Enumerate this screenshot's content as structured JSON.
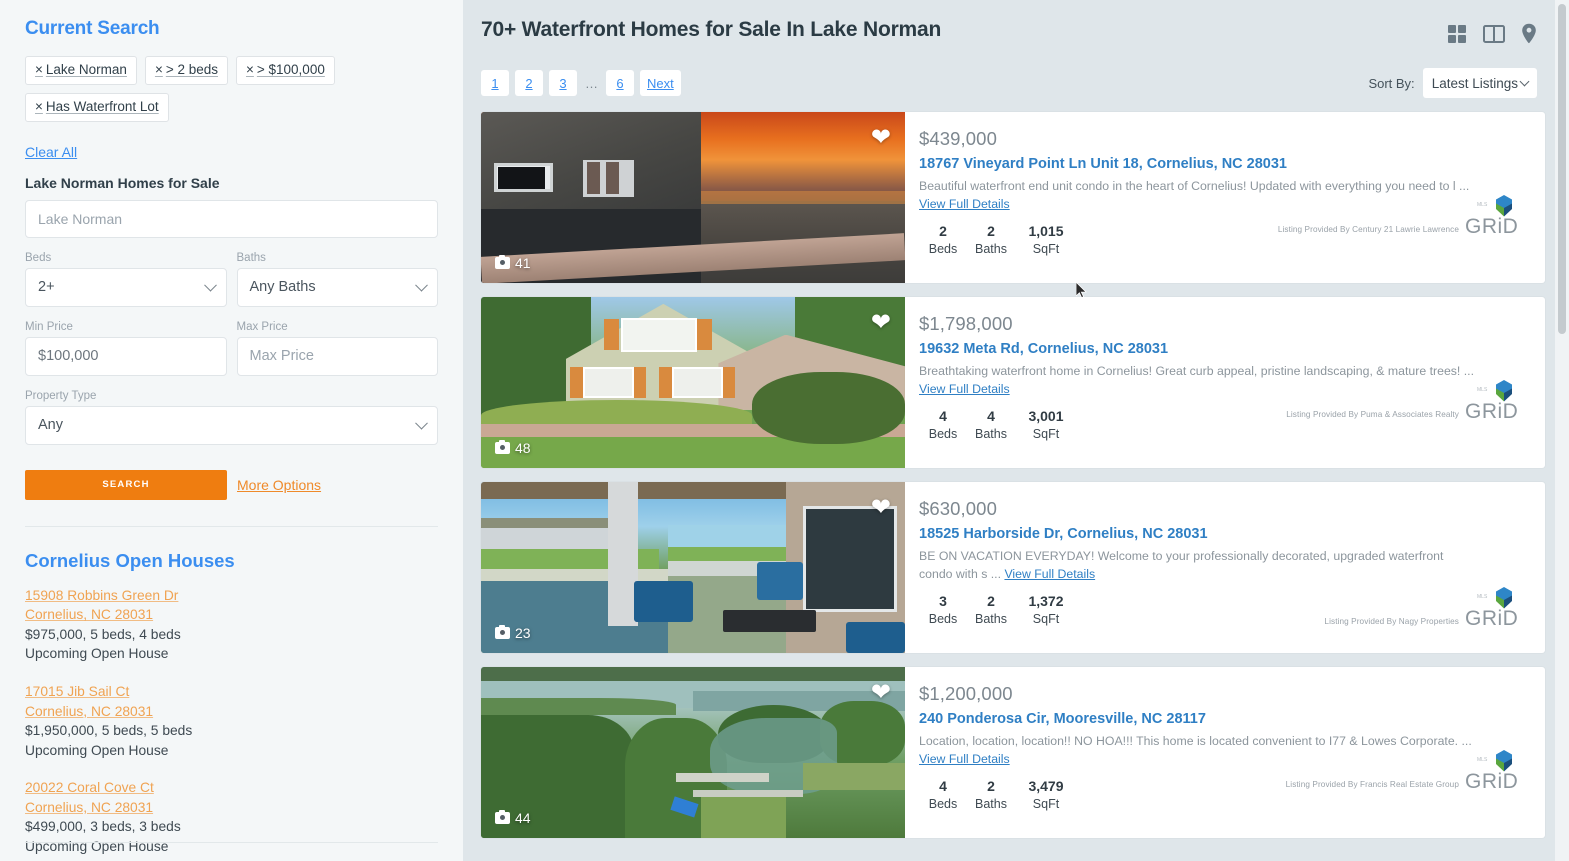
{
  "sidebar": {
    "current_search_title": "Current Search",
    "chips": [
      {
        "x": "×",
        "label": "Lake Norman"
      },
      {
        "x": "×",
        "label": "> 2 beds"
      },
      {
        "x": "×",
        "label": "> $100,000"
      },
      {
        "x": "×",
        "label": "Has Waterfront Lot"
      }
    ],
    "clear_all": "Clear All",
    "location_heading": "Lake Norman Homes for Sale",
    "location_input_value": "Lake Norman",
    "location_input_placeholder": "Lake Norman",
    "beds_label": "Beds",
    "beds_value": "2+",
    "baths_label": "Baths",
    "baths_value": "Any Baths",
    "min_price_label": "Min Price",
    "min_price_value": "$100,000",
    "max_price_label": "Max Price",
    "max_price_placeholder": "Max Price",
    "property_type_label": "Property Type",
    "property_type_value": "Any",
    "search_button": "SEARCH",
    "more_options": "More Options",
    "open_houses_title": "Cornelius Open Houses",
    "open_houses": [
      {
        "street": "15908 Robbins Green Dr",
        "citystatezip": "Cornelius, NC 28031",
        "meta": "$975,000, 5 beds, 4 beds",
        "status": "Upcoming Open House"
      },
      {
        "street": "17015 Jib Sail Ct",
        "citystatezip": "Cornelius, NC 28031",
        "meta": "$1,950,000, 5 beds, 5 beds",
        "status": "Upcoming Open House"
      },
      {
        "street": "20022 Coral Cove Ct",
        "citystatezip": "Cornelius, NC 28031",
        "meta": "$499,000, 3 beds, 3 beds",
        "status": "Upcoming Open House"
      }
    ]
  },
  "main": {
    "title": "70+ Waterfront Homes for Sale In Lake Norman",
    "view_icons": [
      "grid-view-icon",
      "split-view-icon",
      "map-view-icon"
    ],
    "pagination": [
      "1",
      "2",
      "3",
      "…",
      "6",
      "Next"
    ],
    "sort_by_label": "Sort By:",
    "sort_by_value": "Latest Listings",
    "stat_labels": {
      "beds": "Beds",
      "baths": "Baths",
      "sqft": "SqFt"
    },
    "grid_logo_text": "GRiD",
    "grid_logo_mls": "MLS"
  },
  "listings": [
    {
      "price": "$439,000",
      "address": "18767 Vineyard Point Ln Unit 18, Cornelius, NC 28031",
      "description": "Beautiful waterfront end unit condo in the heart of Cornelius! Updated with everything you need to l ...",
      "view_details": "View Full Details",
      "beds": "2",
      "baths": "2",
      "sqft": "1,015",
      "photo_count": "41",
      "provider": "Listing Provided By Century 21 Lawrie Lawrence",
      "favorite": "heart-icon"
    },
    {
      "price": "$1,798,000",
      "address": "19632 Meta Rd, Cornelius, NC 28031",
      "description": "Breathtaking waterfront home in Cornelius! Great curb appeal, pristine landscaping, & mature trees! ...",
      "view_details": "View Full Details",
      "beds": "4",
      "baths": "4",
      "sqft": "3,001",
      "photo_count": "48",
      "provider": "Listing Provided By Puma & Associates Realty",
      "favorite": "heart-icon"
    },
    {
      "price": "$630,000",
      "address": "18525 Harborside Dr, Cornelius, NC 28031",
      "description": "BE ON VACATION EVERYDAY! Welcome to your professionally decorated, upgraded waterfront condo with s ...",
      "view_details": "View Full Details",
      "beds": "3",
      "baths": "2",
      "sqft": "1,372",
      "photo_count": "23",
      "provider": "Listing Provided By Nagy Properties",
      "favorite": "heart-icon"
    },
    {
      "price": "$1,200,000",
      "address": "240 Ponderosa Cir, Mooresville, NC 28117",
      "description": "Location, location, location!! NO HOA!!! This home is located convenient to I77 & Lowes Corporate. ...",
      "view_details": "View Full Details",
      "beds": "4",
      "baths": "2",
      "sqft": "3,479",
      "photo_count": "44",
      "provider": "Listing Provided By Francis Real Estate Group",
      "favorite": "heart-icon"
    }
  ],
  "colors": {
    "accent_blue": "#3b8ef0",
    "link_blue": "#2f7fc4",
    "orange": "#ef7d10",
    "open_house_link": "#f0a352",
    "page_bg": "#dfe6ea",
    "sidebar_bg": "#f4f7f8"
  }
}
